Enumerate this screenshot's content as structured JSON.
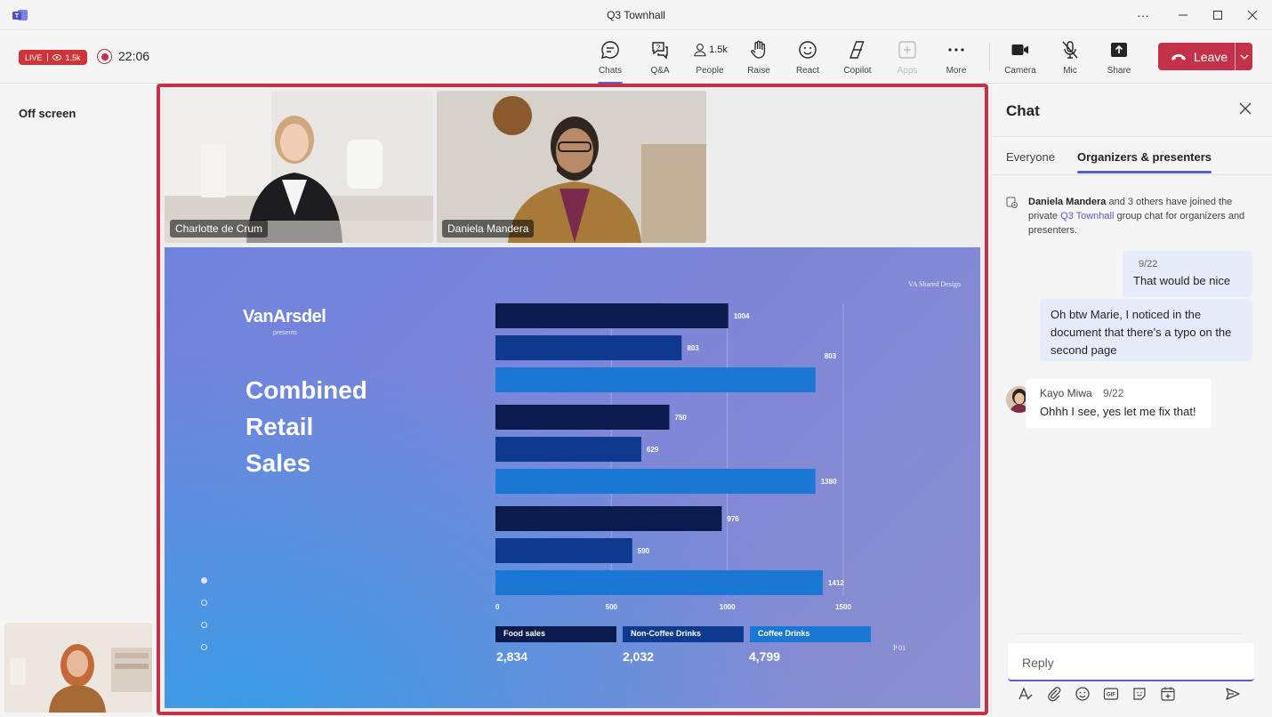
{
  "window": {
    "title": "Q3 Townhall"
  },
  "status": {
    "live_label": "LIVE",
    "viewer_count": "1.5k",
    "timer": "22:06"
  },
  "toolbar": {
    "chats": "Chats",
    "qa": "Q&A",
    "people": "People",
    "people_count": "1.5k",
    "raise": "Raise",
    "react": "React",
    "copilot": "Copilot",
    "apps": "Apps",
    "more": "More",
    "camera": "Camera",
    "mic": "Mic",
    "share": "Share",
    "leave": "Leave"
  },
  "left": {
    "off_screen": "Off screen"
  },
  "participants": [
    {
      "name": "Charlotte de Crum"
    },
    {
      "name": "Daniela Mandera"
    }
  ],
  "slide": {
    "brand": "VanArsdel",
    "presents": "presents",
    "design_tag": "VA Shared Design",
    "title_lines": [
      "Combined",
      "Retail",
      "Sales"
    ],
    "page": "P 01",
    "legend": [
      {
        "label": "Food sales",
        "total": "2,834",
        "color": "#0b1b4d"
      },
      {
        "label": "Non-Coffee Drinks",
        "total": "2,032",
        "color": "#0d3a8f"
      },
      {
        "label": "Coffee Drinks",
        "total": "4,799",
        "color": "#1a78d4"
      }
    ]
  },
  "chart_data": {
    "type": "bar",
    "orientation": "horizontal",
    "groups": 3,
    "series": [
      {
        "name": "Food sales",
        "values": [
          1004,
          750,
          976
        ]
      },
      {
        "name": "Non-Coffee Drinks",
        "values": [
          803,
          629,
          590
        ]
      },
      {
        "name": "Coffee Drinks",
        "values": [
          1380,
          1380,
          1412
        ]
      }
    ],
    "value_labels": [
      [
        "1004",
        "803",
        "803"
      ],
      [
        "750",
        "629",
        "1380"
      ],
      [
        "976",
        "590",
        "1412"
      ]
    ],
    "xticks": [
      0,
      500,
      1000,
      1500
    ],
    "xlim": [
      0,
      1500
    ],
    "grid": true
  },
  "chat": {
    "title": "Chat",
    "tabs": [
      "Everyone",
      "Organizers & presenters"
    ],
    "system_message": {
      "actor": "Daniela Mandera",
      "text_1": " and 3 others have joined the private ",
      "link": "Q3 Townhall",
      "text_2": " group chat for organizers and presenters."
    },
    "messages": [
      {
        "date": "9/22",
        "text": "That would be nice"
      },
      {
        "text": "Oh btw Marie, I noticed in the document that there's a typo on the second page"
      },
      {
        "author": "Kayo Miwa",
        "date": "9/22",
        "text": "Ohhh I see, yes let me fix that!"
      }
    ],
    "reply_placeholder": "Reply"
  },
  "colors": {
    "accent": "#5b5fc7",
    "leave": "#c4314b",
    "live": "#d13438"
  }
}
